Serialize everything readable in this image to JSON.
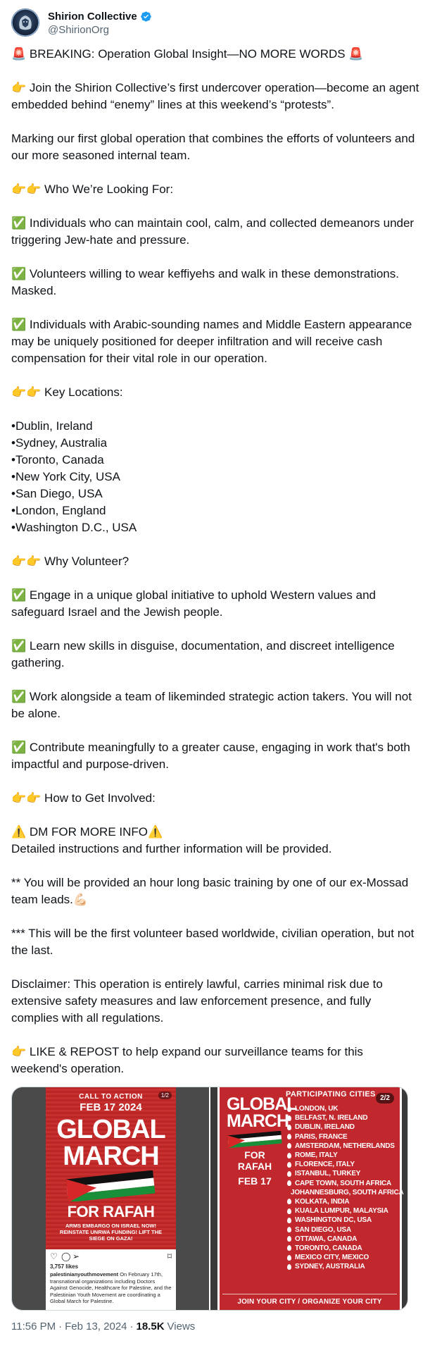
{
  "author": {
    "display_name": "Shirion Collective",
    "handle": "@ShirionOrg",
    "avatar_icon": "lion-logo",
    "verified_icon": "verified-badge-icon",
    "verified_color": "#1d9bf0"
  },
  "tweet": {
    "headline": "🚨 BREAKING: Operation Global Insight—NO MORE WORDS 🚨",
    "intro": "👉 Join the Shirion Collective’s first undercover operation—become an agent embedded behind “enemy” lines at this weekend’s “protests”.",
    "marking": "Marking our first global operation that combines the efforts of volunteers and our more seasoned internal team.",
    "looking_heading": "👉👉 Who We’re Looking For:",
    "looking_items": [
      "✅ Individuals who can maintain cool, calm, and collected demeanors under triggering Jew-hate and pressure.",
      "✅ Volunteers willing to wear keffiyehs and walk in these demonstrations. Masked.",
      "✅ Individuals with Arabic-sounding names and Middle Eastern appearance may be uniquely positioned for deeper infiltration and will receive cash compensation for their vital role in our operation."
    ],
    "locations_heading": "👉👉 Key Locations:",
    "locations": [
      "•Dublin, Ireland",
      "•Sydney, Australia",
      "•Toronto, Canada",
      "•New York City, USA",
      "•San Diego, USA",
      "•London, England",
      "•Washington D.C., USA"
    ],
    "why_heading": "👉👉 Why Volunteer?",
    "why_items": [
      "✅ Engage in a unique global initiative to uphold Western values and safeguard Israel and the Jewish people.",
      "✅ Learn new skills in disguise, documentation, and discreet intelligence gathering.",
      "✅ Work alongside a team of likeminded strategic action takers. You will not be alone.",
      "✅ Contribute meaningfully to a greater cause, engaging in work that's both impactful and purpose-driven."
    ],
    "how_heading": "👉👉 How to Get Involved:",
    "dm_line": "⚠️ DM FOR MORE INFO⚠️",
    "dm_detail": "Detailed instructions and further information will be provided.",
    "training": "** You will be provided an hour long basic training by one of our ex-Mossad team leads.💪🏻",
    "first_op": "*** This will be the first volunteer based worldwide, civilian operation, but not the last.",
    "disclaimer": "Disclaimer: This operation is entirely lawful, carries minimal risk due to extensive safety measures and law enforcement presence, and fully complies with all regulations.",
    "cta": "👉 LIKE & REPOST to help expand our surveillance teams for this weekend's operation."
  },
  "media": {
    "left": {
      "counter": "1/2",
      "poster_call": "CALL TO ACTION",
      "poster_date": "FEB 17 2024",
      "poster_title_1": "GLOBAL",
      "poster_title_2": "MARCH",
      "poster_title_3": "FOR RAFAH",
      "poster_demands": "ARMS EMBARGO ON ISRAEL NOW! REINSTATE UNRWA FUNDING! LIFT THE SIEGE ON GAZA!",
      "likes": "3,757 likes",
      "caption_user": "palestinianyouthmovement",
      "caption_text": " On February 17th, transnational organizations including Doctors Against Genocide, Healthcare for Palestine, and the Palestinian Youth Movement are coordinating a Global March for Palestine."
    },
    "right": {
      "counter": "2/2",
      "heading": "PARTICIPATING CITIES",
      "title_1": "GLOBAL",
      "title_2": "MARCH",
      "title_3": "FOR RAFAH",
      "date": "FEB 17",
      "cities": [
        "LONDON, UK",
        "BELFAST, N. IRELAND",
        "DUBLIN, IRELAND",
        "PARIS, FRANCE",
        "AMSTERDAM, NETHERLANDS",
        "ROME, ITALY",
        "FLORENCE, ITALY",
        "ISTANBUL, TURKEY",
        "CAPE TOWN, SOUTH AFRICA",
        "JOHANNESBURG, SOUTH AFRICA",
        "KOLKATA, INDIA",
        "KUALA LUMPUR, MALAYSIA",
        "WASHINGTON DC, USA",
        "SAN DIEGO, USA",
        "OTTAWA, CANADA",
        "TORONTO, CANADA",
        "MEXICO CITY, MEXICO",
        "SYDNEY, AUSTRALIA"
      ],
      "footer": "JOIN YOUR CITY / ORGANIZE YOUR CITY"
    }
  },
  "meta": {
    "time": "11:56 PM",
    "sep": "·",
    "date": "Feb 13, 2024",
    "views_count": "18.5K",
    "views_label": "Views"
  },
  "colors": {
    "text": "#0f1419",
    "muted": "#536471",
    "poster_red": "#c0282d",
    "link_blue": "#1d9bf0"
  }
}
